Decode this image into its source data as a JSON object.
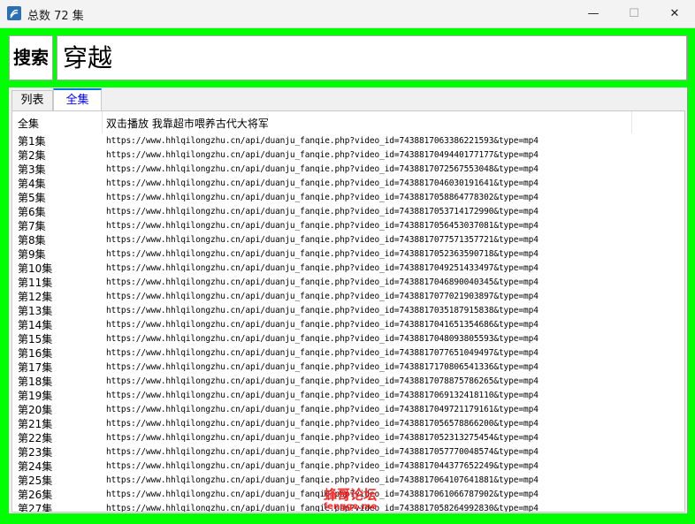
{
  "window": {
    "title": "总数 72 集",
    "app_icon": "app-logo-icon",
    "minimize_glyph": "—",
    "maximize_glyph": "☐",
    "close_glyph": "✕"
  },
  "colors": {
    "frame": "#00ff00",
    "active_tab_text": "#0000ff",
    "active_tab_border": "#0078d7",
    "watermark": "#ff2a2a"
  },
  "search": {
    "button_label": "搜索",
    "value": "穿越"
  },
  "tabs": [
    {
      "label": "列表"
    },
    {
      "label": "全集"
    }
  ],
  "list": {
    "header": {
      "col1": "全集",
      "col2": "双击播放 我靠超市喂养古代大将军"
    },
    "rows": [
      {
        "episode": "第1集",
        "url": "https://www.hhlqilongzhu.cn/api/duanju_fanqie.php?video_id=7438817063386221593&type=mp4"
      },
      {
        "episode": "第2集",
        "url": "https://www.hhlqilongzhu.cn/api/duanju_fanqie.php?video_id=7438817049440177177&type=mp4"
      },
      {
        "episode": "第3集",
        "url": "https://www.hhlqilongzhu.cn/api/duanju_fanqie.php?video_id=7438817072567553048&type=mp4"
      },
      {
        "episode": "第4集",
        "url": "https://www.hhlqilongzhu.cn/api/duanju_fanqie.php?video_id=7438817046030191641&type=mp4"
      },
      {
        "episode": "第5集",
        "url": "https://www.hhlqilongzhu.cn/api/duanju_fanqie.php?video_id=7438817058864778302&type=mp4"
      },
      {
        "episode": "第6集",
        "url": "https://www.hhlqilongzhu.cn/api/duanju_fanqie.php?video_id=7438817053714172990&type=mp4"
      },
      {
        "episode": "第7集",
        "url": "https://www.hhlqilongzhu.cn/api/duanju_fanqie.php?video_id=7438817056453037081&type=mp4"
      },
      {
        "episode": "第8集",
        "url": "https://www.hhlqilongzhu.cn/api/duanju_fanqie.php?video_id=7438817077571357721&type=mp4"
      },
      {
        "episode": "第9集",
        "url": "https://www.hhlqilongzhu.cn/api/duanju_fanqie.php?video_id=7438817052363590718&type=mp4"
      },
      {
        "episode": "第10集",
        "url": "https://www.hhlqilongzhu.cn/api/duanju_fanqie.php?video_id=7438817049251433497&type=mp4"
      },
      {
        "episode": "第11集",
        "url": "https://www.hhlqilongzhu.cn/api/duanju_fanqie.php?video_id=7438817046890040345&type=mp4"
      },
      {
        "episode": "第12集",
        "url": "https://www.hhlqilongzhu.cn/api/duanju_fanqie.php?video_id=7438817077021903897&type=mp4"
      },
      {
        "episode": "第13集",
        "url": "https://www.hhlqilongzhu.cn/api/duanju_fanqie.php?video_id=7438817035187915838&type=mp4"
      },
      {
        "episode": "第14集",
        "url": "https://www.hhlqilongzhu.cn/api/duanju_fanqie.php?video_id=7438817041651354686&type=mp4"
      },
      {
        "episode": "第15集",
        "url": "https://www.hhlqilongzhu.cn/api/duanju_fanqie.php?video_id=7438817048093805593&type=mp4"
      },
      {
        "episode": "第16集",
        "url": "https://www.hhlqilongzhu.cn/api/duanju_fanqie.php?video_id=7438817077651049497&type=mp4"
      },
      {
        "episode": "第17集",
        "url": "https://www.hhlqilongzhu.cn/api/duanju_fanqie.php?video_id=7438817170806541336&type=mp4"
      },
      {
        "episode": "第18集",
        "url": "https://www.hhlqilongzhu.cn/api/duanju_fanqie.php?video_id=7438817078875786265&type=mp4"
      },
      {
        "episode": "第19集",
        "url": "https://www.hhlqilongzhu.cn/api/duanju_fanqie.php?video_id=7438817069132418110&type=mp4"
      },
      {
        "episode": "第20集",
        "url": "https://www.hhlqilongzhu.cn/api/duanju_fanqie.php?video_id=7438817049721179161&type=mp4"
      },
      {
        "episode": "第21集",
        "url": "https://www.hhlqilongzhu.cn/api/duanju_fanqie.php?video_id=7438817056578866200&type=mp4"
      },
      {
        "episode": "第22集",
        "url": "https://www.hhlqilongzhu.cn/api/duanju_fanqie.php?video_id=7438817052313275454&type=mp4"
      },
      {
        "episode": "第23集",
        "url": "https://www.hhlqilongzhu.cn/api/duanju_fanqie.php?video_id=7438817057770048574&type=mp4"
      },
      {
        "episode": "第24集",
        "url": "https://www.hhlqilongzhu.cn/api/duanju_fanqie.php?video_id=7438817044377652249&type=mp4"
      },
      {
        "episode": "第25集",
        "url": "https://www.hhlqilongzhu.cn/api/duanju_fanqie.php?video_id=7438817064107641881&type=mp4"
      },
      {
        "episode": "第26集",
        "url": "https://www.hhlqilongzhu.cn/api/duanju_fanqie.php?video_id=7438817061066787902&type=mp4"
      },
      {
        "episode": "第27集",
        "url": "https://www.hhlqilongzhu.cn/api/duanju_fanqie.php?video_id=7438817058264992830&type=mp4"
      }
    ]
  },
  "watermark": {
    "line1": "蜂哥论坛",
    "line2": "fengge.me"
  }
}
